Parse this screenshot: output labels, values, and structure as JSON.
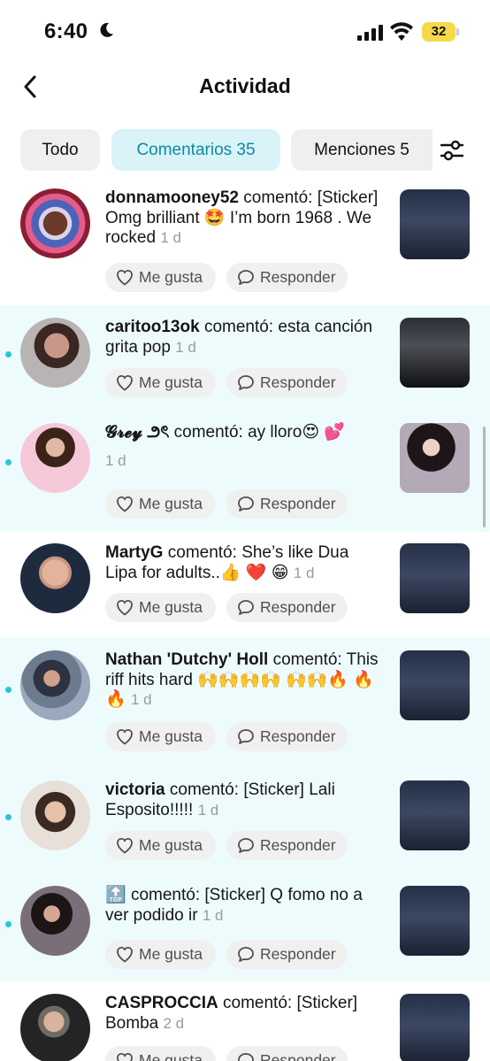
{
  "status_bar": {
    "time": "6:40",
    "battery": "32"
  },
  "header": {
    "title": "Actividad"
  },
  "tabs": [
    {
      "label": "Todo"
    },
    {
      "label": "Comentarios 35"
    },
    {
      "label": "Menciones 5"
    }
  ],
  "labels": {
    "like": "Me gusta",
    "reply": "Responder",
    "commented": "comentó:"
  },
  "items": [
    {
      "user": "donnamooney52",
      "text": "[Sticker] Omg brilliant 🤩 I’m born 1968 . We rocked",
      "ago": "1 d",
      "unread": false
    },
    {
      "user": "caritoo13ok",
      "text": "esta canción grita pop",
      "ago": "1 d",
      "unread": true
    },
    {
      "user": "𝓖𝓻𝓮𝔂 ౨ৎ",
      "text": "ay lloro😍 💕",
      "ago": "1 d",
      "unread": true
    },
    {
      "user": "MartyG",
      "text": "She’s like Dua Lipa for adults..👍 ❤️ 😁",
      "ago": "1 d",
      "unread": false
    },
    {
      "user": "Nathan 'Dutchy' Holl",
      "text": "This riff hits hard 🙌🙌🙌🙌 🙌🙌🔥 🔥 🔥",
      "ago": "1 d",
      "unread": true
    },
    {
      "user": "victoria",
      "text": "[Sticker] Lali Esposito!!!!!",
      "ago": "1 d",
      "unread": true
    },
    {
      "user": "🔝",
      "text": "[Sticker] Q fomo no a ver podido ir",
      "ago": "1 d",
      "unread": true
    },
    {
      "user": "CASPROCCIA",
      "text": "[Sticker] Bomba",
      "ago": "2 d",
      "unread": false
    }
  ],
  "colors": {
    "accent": "#0b8ba0",
    "tab_active_bg": "#d9f3f8",
    "unread_bg": "#eefbfd",
    "unread_dot": "#29c4dc",
    "battery": "#f7d84a"
  },
  "icons": [
    "moon-icon",
    "cellular-signal-icon",
    "wifi-icon",
    "back-chevron-icon",
    "filter-sliders-icon",
    "heart-icon",
    "speech-bubble-icon"
  ]
}
